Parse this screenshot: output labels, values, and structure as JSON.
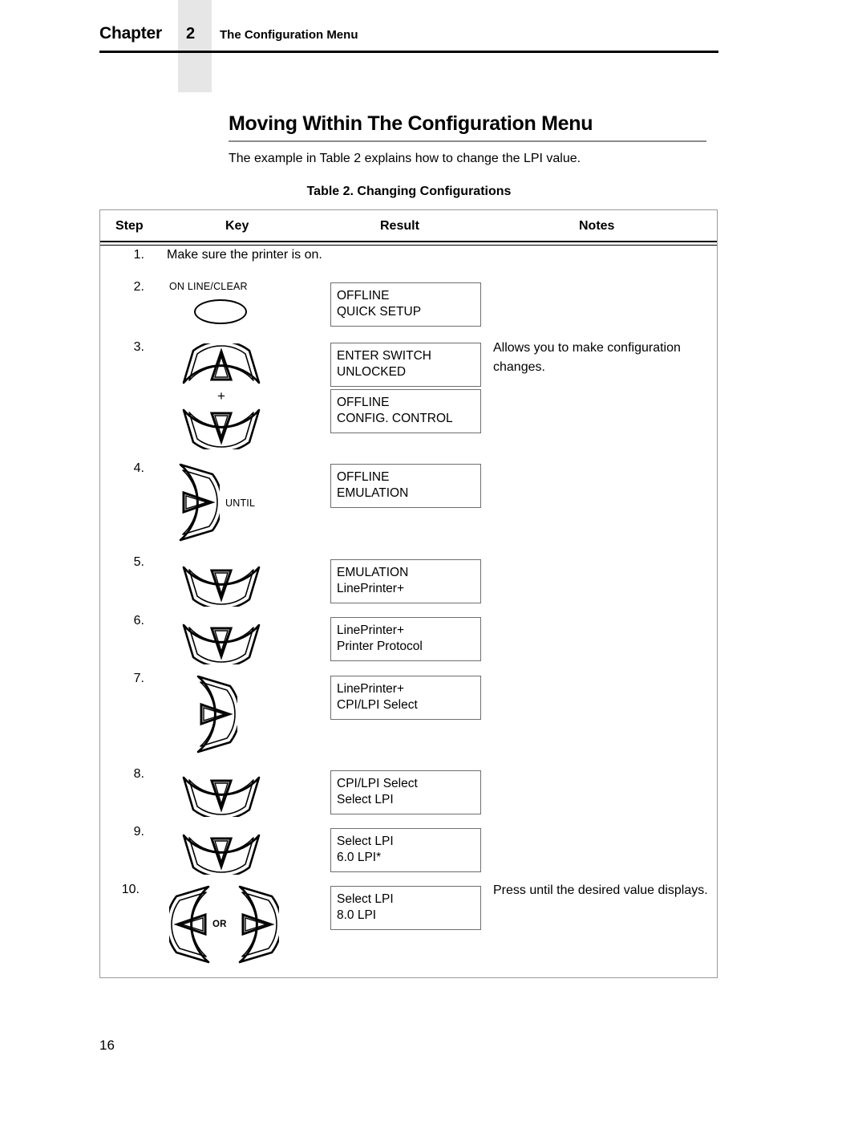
{
  "header": {
    "chapter_word": "Chapter",
    "chapter_number": "2",
    "chapter_title": "The Configuration Menu"
  },
  "section": {
    "title": "Moving Within The Configuration Menu",
    "intro": "The example in Table 2 explains how to change the LPI value."
  },
  "table": {
    "caption": "Table 2. Changing Configurations",
    "columns": [
      "Step",
      "Key",
      "Result",
      "Notes"
    ],
    "rows": [
      {
        "step": "1.",
        "key_icons": [],
        "plain_text": "Make sure the printer is on.",
        "results": [],
        "notes": ""
      },
      {
        "step": "2.",
        "key_icons": [
          {
            "type": "oval",
            "label": "ON LINE/CLEAR"
          }
        ],
        "results": [
          {
            "lines": [
              "OFFLINE",
              "QUICK SETUP"
            ]
          }
        ],
        "notes": ""
      },
      {
        "step": "3.",
        "key_icons": [
          {
            "type": "fan-up",
            "label": ""
          },
          {
            "type": "plus",
            "label": "+"
          },
          {
            "type": "fan-down",
            "label": ""
          }
        ],
        "results": [
          {
            "lines": [
              "ENTER SWITCH",
              "UNLOCKED"
            ]
          },
          {
            "lines": [
              "OFFLINE",
              "CONFIG. CONTROL"
            ]
          }
        ],
        "notes": "Allows you to make configuration changes."
      },
      {
        "step": "4.",
        "key_icons": [
          {
            "type": "fan-right",
            "label": "UNTIL"
          }
        ],
        "results": [
          {
            "lines": [
              "OFFLINE",
              "EMULATION"
            ]
          }
        ],
        "notes": ""
      },
      {
        "step": "5.",
        "key_icons": [
          {
            "type": "fan-down",
            "label": ""
          }
        ],
        "results": [
          {
            "lines": [
              "EMULATION",
              "LinePrinter+"
            ]
          }
        ],
        "notes": ""
      },
      {
        "step": "6.",
        "key_icons": [
          {
            "type": "fan-down",
            "label": ""
          }
        ],
        "results": [
          {
            "lines": [
              "LinePrinter+",
              "Printer Protocol"
            ]
          }
        ],
        "notes": ""
      },
      {
        "step": "7.",
        "key_icons": [
          {
            "type": "fan-right",
            "label": ""
          }
        ],
        "results": [
          {
            "lines": [
              "LinePrinter+",
              "CPI/LPI Select"
            ]
          }
        ],
        "notes": ""
      },
      {
        "step": "8.",
        "key_icons": [
          {
            "type": "fan-down",
            "label": ""
          }
        ],
        "results": [
          {
            "lines": [
              "CPI/LPI Select",
              "Select LPI"
            ]
          }
        ],
        "notes": ""
      },
      {
        "step": "9.",
        "key_icons": [
          {
            "type": "fan-down",
            "label": ""
          }
        ],
        "results": [
          {
            "lines": [
              "Select LPI",
              "6.0 LPI*"
            ]
          }
        ],
        "notes": ""
      },
      {
        "step": "10.",
        "key_icons": [
          {
            "type": "fan-left",
            "label": ""
          },
          {
            "type": "or",
            "label": "OR"
          },
          {
            "type": "fan-right",
            "label": ""
          }
        ],
        "results": [
          {
            "lines": [
              "Select LPI",
              "8.0 LPI"
            ]
          }
        ],
        "notes": "Press until the desired value displays."
      }
    ]
  },
  "footer": {
    "page_number": "16"
  }
}
